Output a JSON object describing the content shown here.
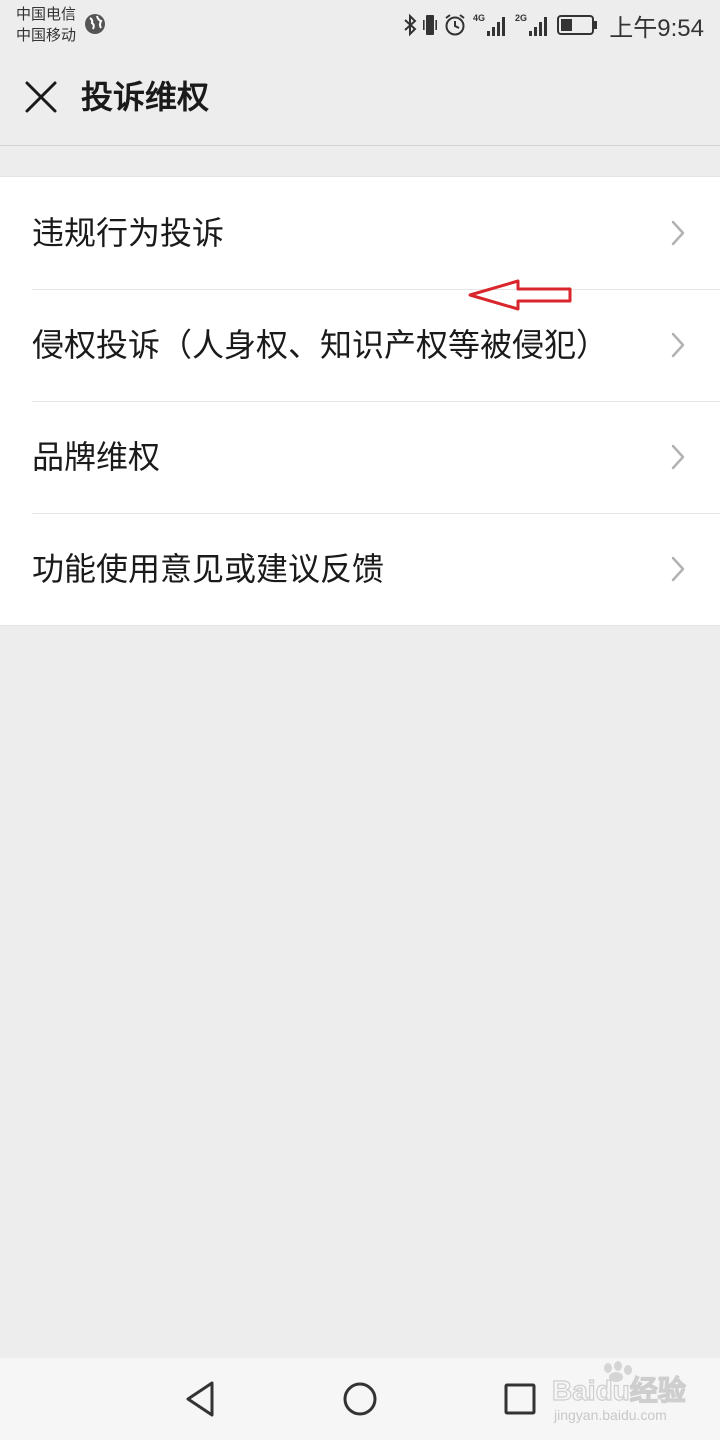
{
  "status_bar": {
    "carrier_1": "中国电信",
    "carrier_2": "中国移动",
    "net_4g": "4G",
    "net_2g": "2G",
    "time": "上午9:54"
  },
  "header": {
    "title": "投诉维权"
  },
  "menu": {
    "items": [
      {
        "label": "违规行为投诉"
      },
      {
        "label": "侵权投诉（人身权、知识产权等被侵犯）"
      },
      {
        "label": "品牌维权"
      },
      {
        "label": "功能使用意见或建议反馈"
      }
    ]
  },
  "watermark": {
    "brand": "Baidu经验",
    "url": "jingyan.baidu.com"
  },
  "colors": {
    "background": "#ededed",
    "panel": "#ffffff",
    "annotation_arrow": "#d9262c"
  }
}
